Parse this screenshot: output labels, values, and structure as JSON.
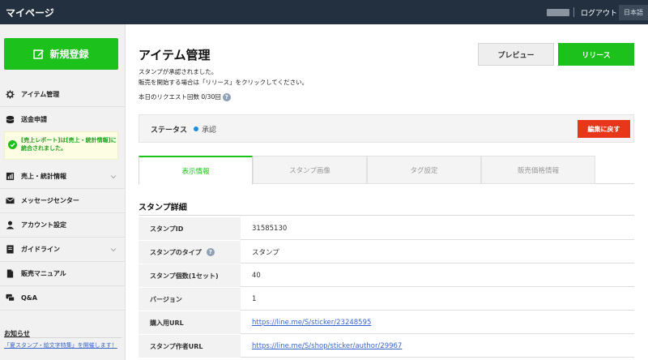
{
  "header": {
    "title": "マイページ",
    "logout": "ログアウト",
    "language": "日本語"
  },
  "sidebar": {
    "new_button": "新規登録",
    "items": [
      {
        "label": "アイテム管理",
        "icon": "gear-icon"
      },
      {
        "label": "送金申請",
        "icon": "coin-icon"
      },
      {
        "label": "売上・統計情報",
        "icon": "chart-icon"
      },
      {
        "label": "メッセージセンター",
        "icon": "mail-icon"
      },
      {
        "label": "アカウント設定",
        "icon": "user-icon"
      },
      {
        "label": "ガイドライン",
        "icon": "book-icon"
      },
      {
        "label": "販売マニュアル",
        "icon": "document-icon"
      },
      {
        "label": "Q&A",
        "icon": "chat-icon"
      }
    ],
    "notice": "[売上レポート]は[売上・統計情報]に統合されました。",
    "oshirase_title": "お知らせ",
    "news_link": "「夏スタンプ・絵文字特集」を開催します！"
  },
  "main": {
    "title": "アイテム管理",
    "message_line1": "スタンプが承認されました。",
    "message_line2": "販売を開始する場合は「リリース」をクリックしてください。",
    "request_count": "本日のリクエスト回数 0/30回",
    "preview_button": "プレビュー",
    "release_button": "リリース",
    "status_label": "ステータス",
    "status_value": "承認",
    "back_button": "編集に戻す",
    "tabs": [
      "表示情報",
      "スタンプ画像",
      "タグ設定",
      "販売価格情報"
    ],
    "section_title": "スタンプ詳細",
    "details": [
      {
        "label": "スタンプID",
        "value": "31585130"
      },
      {
        "label": "スタンプのタイプ",
        "value": "スタンプ"
      },
      {
        "label": "スタンプ個数(1セット)",
        "value": "40"
      },
      {
        "label": "バージョン",
        "value": "1"
      },
      {
        "label": "購入用URL",
        "value": "https://line.me/S/sticker/23248595"
      },
      {
        "label": "スタンプ作者URL",
        "value": "https://line.me/S/shop/sticker/author/29967"
      }
    ]
  },
  "colors": {
    "brand_green": "#1cc11c",
    "topbar": "#22303f",
    "danger": "#e8361b",
    "status_blue": "#1a8de0"
  }
}
